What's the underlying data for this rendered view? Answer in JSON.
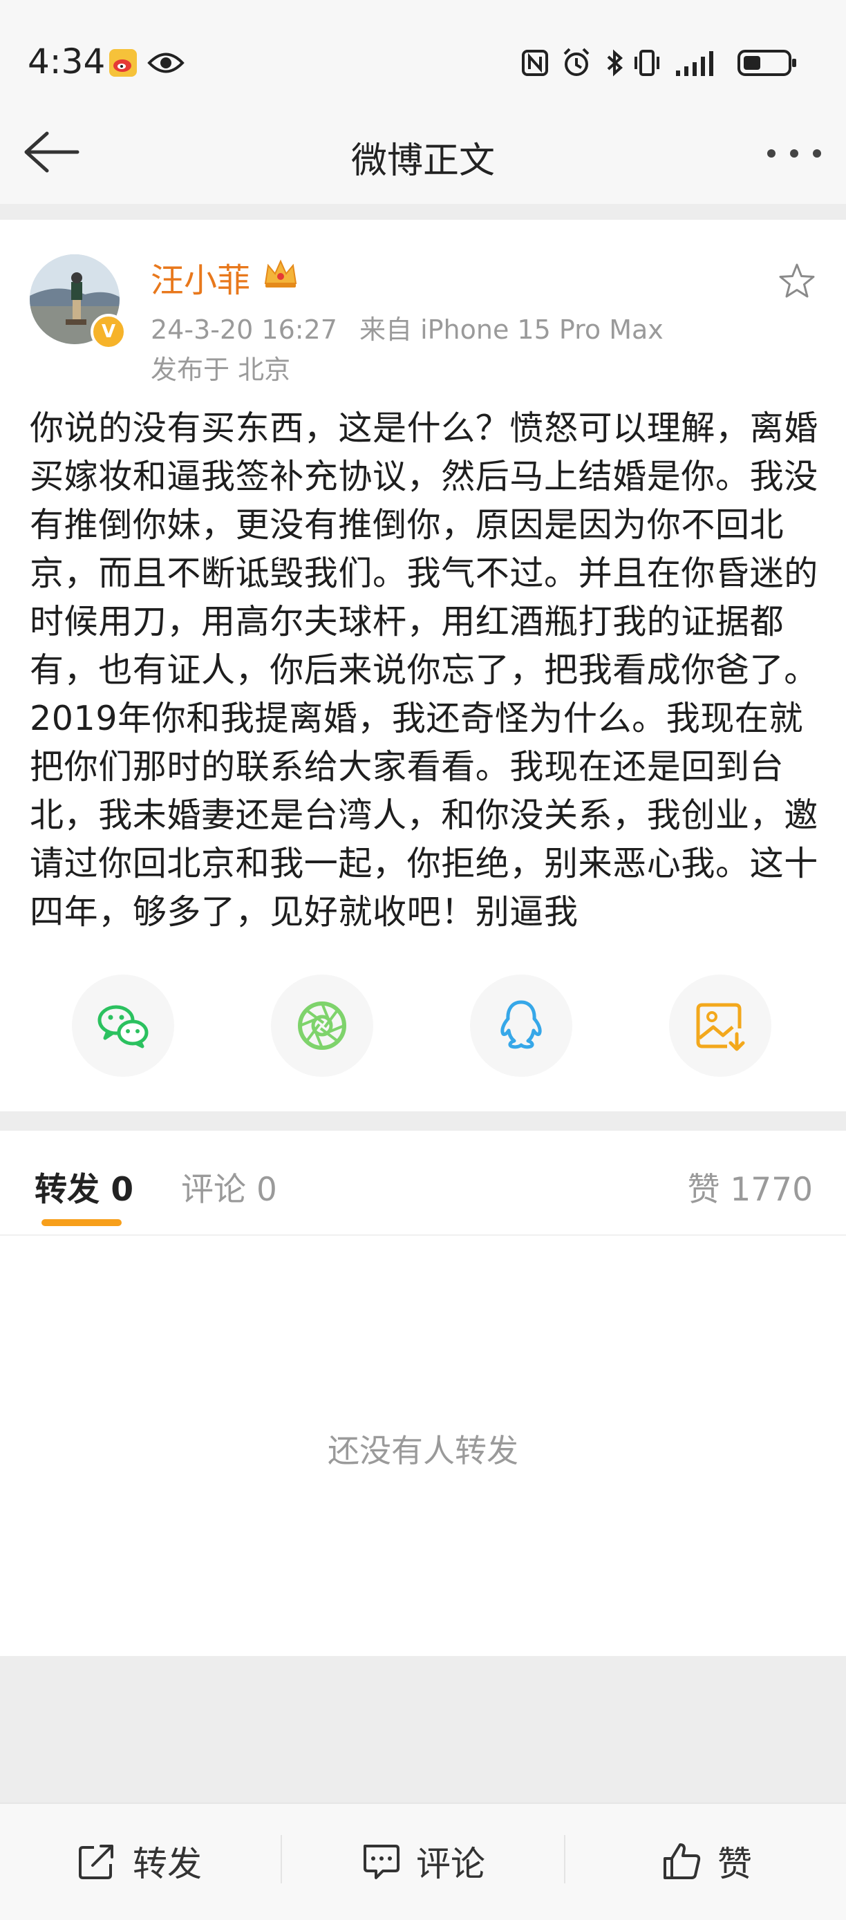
{
  "status_bar": {
    "time": "4:34"
  },
  "nav": {
    "title": "微博正文"
  },
  "post": {
    "username": "汪小菲",
    "verified_badge": "V",
    "timestamp": "24-3-20 16:27",
    "source": "来自 iPhone 15 Pro Max",
    "location": "发布于 北京",
    "content": "你说的没有买东西，这是什么？愤怒可以理解，离婚买嫁妆和逼我签补充协议，然后马上结婚是你。我没有推倒你妹，更没有推倒你，原因是因为你不回北京，而且不断诋毁我们。我气不过。并且在你昏迷的时候用刀，用高尔夫球杆，用红酒瓶打我的证据都有，也有证人，你后来说你忘了，把我看成你爸了。2019年你和我提离婚，我还奇怪为什么。我现在就把你们那时的联系给大家看看。我现在还是回到台北，我未婚妻还是台湾人，和你没关系，我创业，邀请过你回北京和我一起，你拒绝，别来恶心我。这十四年，够多了，见好就收吧！别逼我"
  },
  "share_icons": [
    "wechat-icon",
    "moments-icon",
    "qq-icon",
    "save-image-icon"
  ],
  "tabs": {
    "forward": "转发 0",
    "comment": "评论 0",
    "like": "赞 1770"
  },
  "empty_state": "还没有人转发",
  "bottom_bar": {
    "forward": "转发",
    "comment": "评论",
    "like": "赞"
  },
  "colors": {
    "username": "#e8781c",
    "tab_underline": "#f79f1b",
    "wechat": "#2bc15f",
    "moments": "#7ed36b",
    "qq": "#36a7e8",
    "save": "#f3a81c"
  }
}
